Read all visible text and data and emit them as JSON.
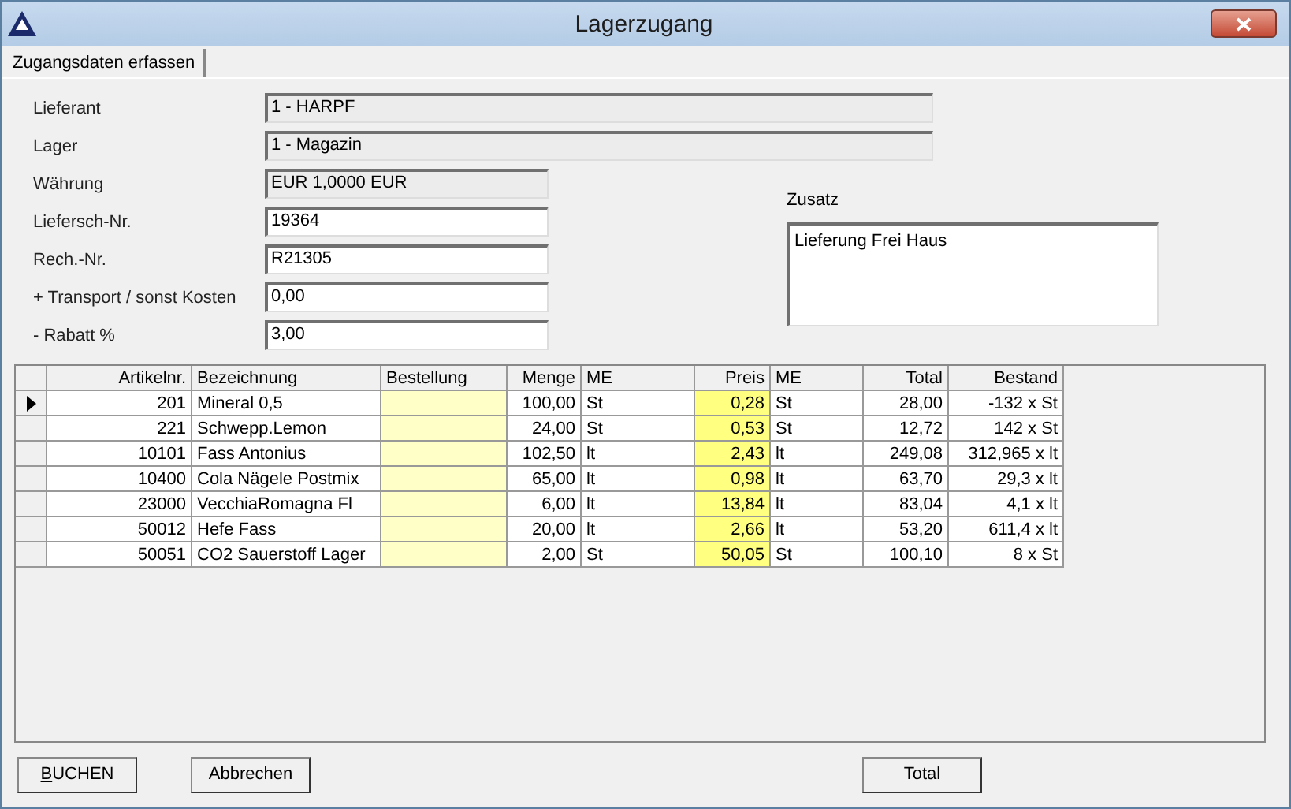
{
  "window": {
    "title": "Lagerzugang"
  },
  "tabs": [
    {
      "label": "Zugangsdaten erfassen",
      "selected": true
    }
  ],
  "fields": [
    {
      "label": "Lieferant",
      "value": "1 - HARPF",
      "kind": "wide",
      "disabled": true
    },
    {
      "label": "Lager",
      "value": "1 -  Magazin",
      "kind": "wide",
      "disabled": true
    },
    {
      "label": "Währung",
      "value": "EUR  1,0000 EUR",
      "kind": "short",
      "disabled": true
    },
    {
      "label": "Liefersch-Nr.",
      "value": "19364",
      "kind": "short",
      "disabled": false
    },
    {
      "label": "Rech.-Nr.",
      "value": "R21305",
      "kind": "short",
      "disabled": false
    },
    {
      "label": "+ Transport / sonst Kosten",
      "value": "0,00",
      "kind": "short",
      "disabled": false
    },
    {
      "label": "- Rabatt %",
      "value": "3,00",
      "kind": "short",
      "disabled": false
    }
  ],
  "note": {
    "label": "Zusatz",
    "value": "Lieferung Frei Haus"
  },
  "table": {
    "columns": [
      {
        "label": "Artikelnr.",
        "kind": "number"
      },
      {
        "label": "Bezeichnung",
        "kind": "text"
      },
      {
        "label": "Bestellung",
        "kind": "order"
      },
      {
        "label": "Menge",
        "kind": "number"
      },
      {
        "label": "ME",
        "kind": "text"
      },
      {
        "label": "Preis",
        "kind": "price"
      },
      {
        "label": "ME",
        "kind": "text"
      },
      {
        "label": "Total",
        "kind": "number"
      },
      {
        "label": "Bestand",
        "kind": "number"
      }
    ],
    "rows": [
      {
        "selected": true,
        "cells": [
          "201",
          "Mineral 0,5",
          "",
          "100,00",
          "St",
          "0,28",
          "St",
          "28,00",
          "-132 x St"
        ]
      },
      {
        "selected": false,
        "cells": [
          "221",
          "Schwepp.Lemon",
          "",
          "24,00",
          "St",
          "0,53",
          "St",
          "12,72",
          "142 x St"
        ]
      },
      {
        "selected": false,
        "cells": [
          "10101",
          "Fass Antonius",
          "",
          "102,50",
          "lt",
          "2,43",
          "lt",
          "249,08",
          "312,965 x lt"
        ]
      },
      {
        "selected": false,
        "cells": [
          "10400",
          "Cola Nägele Postmix",
          "",
          "65,00",
          "lt",
          "0,98",
          "lt",
          "63,70",
          "29,3 x lt"
        ]
      },
      {
        "selected": false,
        "cells": [
          "23000",
          "VecchiaRomagna Fl",
          "",
          "6,00",
          "lt",
          "13,84",
          "lt",
          "83,04",
          "4,1 x lt"
        ]
      },
      {
        "selected": false,
        "cells": [
          "50012",
          "Hefe Fass",
          "",
          "20,00",
          "lt",
          "2,66",
          "lt",
          "53,20",
          "611,4 x lt"
        ]
      },
      {
        "selected": false,
        "cells": [
          "50051",
          "CO2 Sauerstoff Lager",
          "",
          "2,00",
          "St",
          "50,05",
          "St",
          "100,10",
          "8 x St"
        ]
      }
    ]
  },
  "buttons": [
    {
      "label": "BUCHEN",
      "underline_first": true,
      "kind": "left"
    },
    {
      "label": "Abbrechen",
      "underline_first": false,
      "kind": "left"
    },
    {
      "label": "Total",
      "underline_first": false,
      "kind": "right"
    }
  ]
}
